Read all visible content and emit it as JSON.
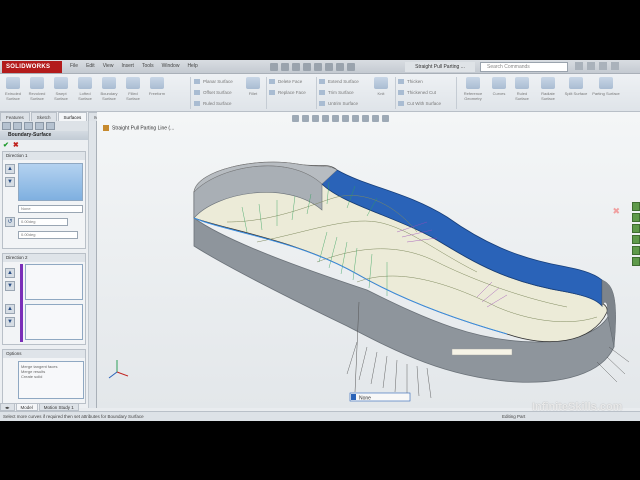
{
  "app": {
    "brand": "SOLIDWORKS",
    "menus": [
      "File",
      "Edit",
      "View",
      "Insert",
      "Tools",
      "Window",
      "Help"
    ],
    "document_title": "Straight Pull Parting ...",
    "search_placeholder": "Search Commands"
  },
  "command_manager": {
    "large_buttons": [
      "Extruded Surface",
      "Revolved Surface",
      "Swept Surface",
      "Lofted Surface",
      "Boundary Surface",
      "Filled Surface",
      "Freeform"
    ],
    "group_a": [
      "Planar Surface",
      "Offset Surface",
      "Ruled Surface"
    ],
    "fillet_label": "Fillet",
    "group_b": [
      "Delete Face",
      "Replace Face"
    ],
    "group_c": [
      "Extend Surface",
      "Trim Surface",
      "Untrim Surface"
    ],
    "group_d": [
      "Knit",
      "Thicken"
    ],
    "group_e": [
      "Surface",
      "Thickened Cut",
      "Cut With Surface"
    ],
    "right_buttons": [
      "Reference Geometry",
      "Curves",
      "Ruled Surface",
      "Radiate Surface",
      "Split Surface",
      "Parting Surface"
    ]
  },
  "tabs": [
    "Features",
    "Sketch",
    "Surfaces",
    "Mold Tools",
    "Evaluate",
    "DimXpertManager",
    "Office Products"
  ],
  "active_tab": "Surfaces",
  "property_manager": {
    "title": "Boundary-Surface",
    "direction1_label": "Direction 1",
    "combo1": "None",
    "combo2": "0.00deg",
    "combo3": "0.00deg",
    "direction2_label": "Direction 2",
    "options_label": "Options",
    "option_text": [
      "Merge tangent faces",
      "Merge results",
      "Create solid"
    ]
  },
  "viewport": {
    "tree_flyout_label": "Straight Pull Parting Line (...",
    "callout_label": "None"
  },
  "bottom_tabs": [
    "Model",
    "Motion Study 1"
  ],
  "active_bottom_tab": "Model",
  "status": {
    "message": "Select more curves if required then set attributes for Boundary Surface",
    "right_text": "Editing Part"
  },
  "watermark": "InfiniteSkills.com",
  "colors": {
    "accent_blue": "#2a63b8",
    "surface_gray": "#9aa1a8",
    "brand_red": "#b31b1b",
    "ok_green": "#1d9a2b"
  }
}
